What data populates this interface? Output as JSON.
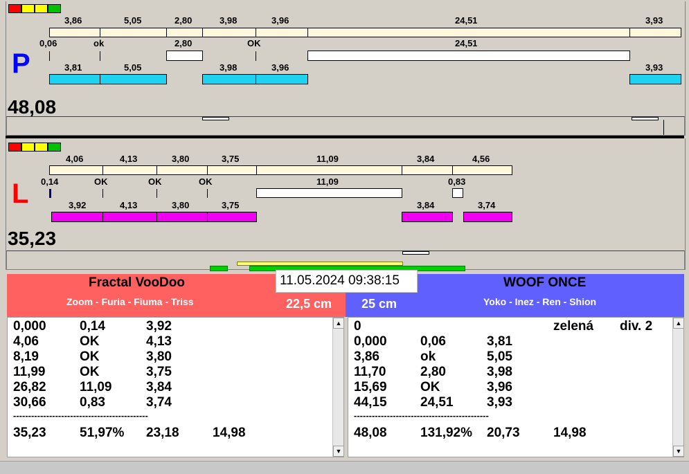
{
  "lamps": {
    "colors": [
      "#ff0000",
      "#ffff00",
      "#ffff00",
      "#00c000"
    ]
  },
  "top": {
    "side_label": "P",
    "side_color": "#0000ff",
    "total": "48,08",
    "upper_labels": [
      "3,86",
      "5,05",
      "2,80",
      "3,98",
      "3,96",
      "24,51",
      "3,93"
    ],
    "middle_labels": [
      "0,06",
      "ok",
      "2,80",
      "OK",
      "24,51"
    ],
    "lower_labels": [
      "3,81",
      "5,05",
      "3,98",
      "3,96",
      "3,93"
    ]
  },
  "bottom": {
    "side_label": "L",
    "side_color": "#ff0000",
    "total": "35,23",
    "upper_labels": [
      "4,06",
      "4,13",
      "3,80",
      "3,75",
      "11,09",
      "3,84",
      "4,56"
    ],
    "middle_labels": [
      "0,14",
      "OK",
      "OK",
      "OK",
      "11,09",
      "0,83"
    ],
    "lower_labels": [
      "3,92",
      "4,13",
      "3,80",
      "3,75",
      "3,84",
      "3,74"
    ]
  },
  "datetime": "11.05.2024 09:38:15",
  "left_team": {
    "name": "Fractal VooDoo",
    "members": "Zoom - Furia - Fiuma - Triss",
    "distance": "22,5 cm",
    "color": "#ff6060",
    "rows": [
      [
        "0,000",
        "0,14",
        "3,92"
      ],
      [
        "4,06",
        "OK",
        "4,13"
      ],
      [
        "8,19",
        "OK",
        "3,80"
      ],
      [
        "11,99",
        "OK",
        "3,75"
      ],
      [
        "26,82",
        "11,09",
        "3,84"
      ],
      [
        "30,66",
        "0,83",
        "3,74"
      ]
    ],
    "divider": "---------------------------------------------",
    "summary": [
      "35,23",
      "51,97%",
      "23,18",
      "14,98"
    ]
  },
  "right_team": {
    "name": "WOOF ONCE",
    "members": "Yoko - Inez - Ren - Shion",
    "distance": "25 cm",
    "color": "#6060ff",
    "header_row": [
      "0",
      "zelená",
      "div. 2"
    ],
    "rows": [
      [
        "0,000",
        "0,06",
        "3,81"
      ],
      [
        "3,86",
        "ok",
        "5,05"
      ],
      [
        "11,70",
        "2,80",
        "3,98"
      ],
      [
        "15,69",
        "OK",
        "3,96"
      ],
      [
        "44,15",
        "24,51",
        "3,93"
      ]
    ],
    "divider": "---------------------------------------------",
    "summary": [
      "48,08",
      "131,92%",
      "20,73",
      "14,98"
    ]
  }
}
